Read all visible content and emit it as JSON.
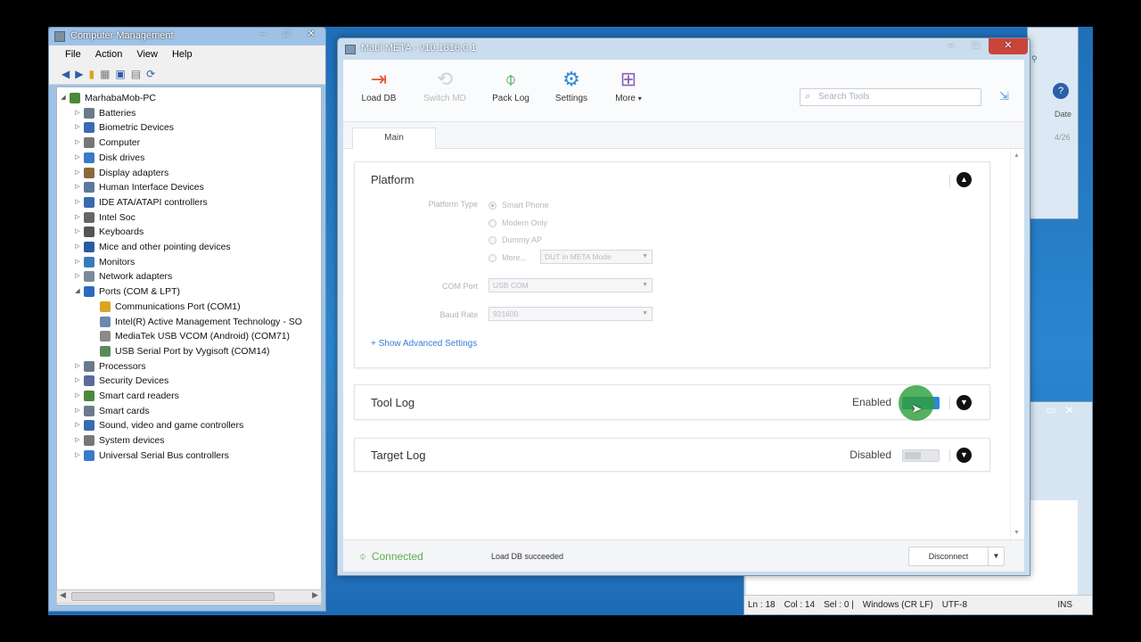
{
  "computer_management": {
    "title": "Computer Management",
    "window_controls": [
      "–",
      "□",
      "✕"
    ],
    "menu": [
      "File",
      "Action",
      "View",
      "Help"
    ],
    "tree": {
      "root": "MarhabaMob-PC",
      "items": [
        "Batteries",
        "Biometric Devices",
        "Computer",
        "Disk drives",
        "Display adapters",
        "Human Interface Devices",
        "IDE ATA/ATAPI controllers",
        "Intel Soc",
        "Keyboards",
        "Mice and other pointing devices",
        "Monitors",
        "Network adapters",
        "Ports (COM & LPT)"
      ],
      "ports_children": [
        "Communications Port (COM1)",
        "Intel(R) Active Management Technology - SO",
        "MediaTek USB VCOM (Android) (COM71)",
        "USB Serial Port by Vygisoft (COM14)"
      ],
      "items_after": [
        "Processors",
        "Security Devices",
        "Smart card readers",
        "Smart cards",
        "Sound, video and game controllers",
        "System devices",
        "Universal Serial Bus controllers"
      ]
    }
  },
  "background_window": {
    "header_labels": [
      "Date",
      "4/26"
    ],
    "status": [
      "Ln : 18",
      "Col : 14",
      "Sel : 0 |",
      "Windows (CR LF)",
      "UTF-8",
      "INS"
    ]
  },
  "maui": {
    "title": "Maui META - v10.1816.0.1",
    "toolbar": {
      "load_db": "Load DB",
      "switch_md": "Switch MD",
      "pack_log": "Pack Log",
      "settings": "Settings",
      "more": "More"
    },
    "search_placeholder": "Search Tools",
    "tab": "Main",
    "platform": {
      "title": "Platform",
      "platform_type_label": "Platform Type",
      "options": [
        "Smart Phone",
        "Modem Only",
        "Dummy AP",
        "More..."
      ],
      "more_select": "DUT in META Mode",
      "com_port_label": "COM Port",
      "com_port_value": "USB COM",
      "baud_rate_label": "Baud Rate",
      "baud_rate_value": "921600",
      "advanced_link": "+ Show Advanced Settings"
    },
    "tool_log": {
      "title": "Tool Log",
      "state": "Enabled",
      "enabled": true
    },
    "target_log": {
      "title": "Target Log",
      "state": "Disabled",
      "enabled": false
    },
    "status": {
      "connection": "Connected",
      "message": "Load DB succeeded",
      "disconnect": "Disconnect"
    }
  },
  "colors": {
    "accent": "#2f86d6",
    "connected": "#5cae4e",
    "link": "#3a7bd5",
    "click_marker": "#2ea03c"
  }
}
